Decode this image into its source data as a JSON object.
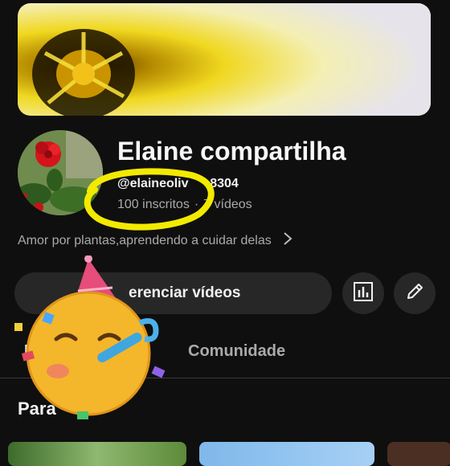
{
  "channel": {
    "title": "Elaine compartilha",
    "handle": "@elaineoliv      8304",
    "subscribers": "100 inscritos",
    "separator": "·",
    "videos": "7 vídeos",
    "description": "Amor por plantas,aprendendo a cuidar delas"
  },
  "actions": {
    "manage_label": "erenciar vídeos",
    "analytics_icon": "bar-chart-icon",
    "edit_icon": "pencil-icon"
  },
  "tabs": [
    {
      "label": "In"
    },
    {
      "label": "s"
    },
    {
      "label": "Comunidade"
    }
  ],
  "section": {
    "title": "Para"
  },
  "overlays": {
    "sticker": "party-face-emoji",
    "annotation": "yellow-hand-drawn-circle"
  },
  "colors": {
    "background": "#0f0f0f",
    "surface": "#272727",
    "text_primary": "#f1f1f1",
    "text_secondary": "#aaaaaa",
    "highlight": "#f2ea00"
  }
}
